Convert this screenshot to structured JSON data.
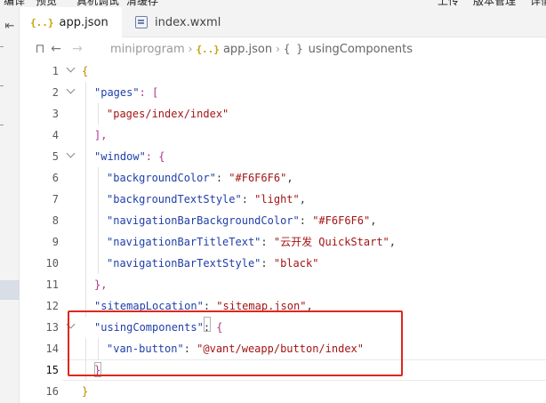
{
  "menubar": {
    "left_items": [
      "编译",
      "预览",
      "真机调试",
      "清缓存"
    ],
    "right_items": [
      "上传",
      "版本管理",
      "详情"
    ]
  },
  "tabs": [
    {
      "label": "app.json",
      "icon": "json-file-icon",
      "active": true
    },
    {
      "label": "index.wxml",
      "icon": "wxml-file-icon",
      "active": false
    }
  ],
  "breadcrumb": {
    "folder": "miniprogram",
    "file_icon": "{..}",
    "file": "app.json",
    "symbol_icon": "{ }",
    "symbol": "usingComponents"
  },
  "editor": {
    "line_numbers": [
      "1",
      "2",
      "3",
      "4",
      "5",
      "6",
      "7",
      "8",
      "9",
      "10",
      "11",
      "12",
      "13",
      "14",
      "15",
      "16"
    ],
    "lines": {
      "l1": "{",
      "l2_key": "\"pages\"",
      "l2_rest": ": [",
      "l3": "\"pages/index/index\"",
      "l4": "],",
      "l5_key": "\"window\"",
      "l5_rest": ": {",
      "l6_key": "\"backgroundColor\"",
      "l6_val": "\"#F6F6F6\"",
      "l7_key": "\"backgroundTextStyle\"",
      "l7_val": "\"light\"",
      "l8_key": "\"navigationBarBackgroundColor\"",
      "l8_val": "\"#F6F6F6\"",
      "l9_key": "\"navigationBarTitleText\"",
      "l9_val": "\"云开发 QuickStart\"",
      "l10_key": "\"navigationBarTextStyle\"",
      "l10_val": "\"black\"",
      "l11": "},",
      "l12_key": "\"sitemapLocation\"",
      "l12_val": "\"sitemap.json\"",
      "l13_key": "\"usingComponents\"",
      "l13_rest": ": ",
      "l13_brace": "{",
      "l14_key": "\"van-button\"",
      "l14_val": "\"@vant/weapp/button/index\"",
      "l15": "}",
      "l16": "}"
    }
  },
  "colors": {
    "key": "#1f3fa8",
    "string": "#a31515",
    "highlight_box": "#e0261c",
    "json_icon": "#c6a000"
  }
}
